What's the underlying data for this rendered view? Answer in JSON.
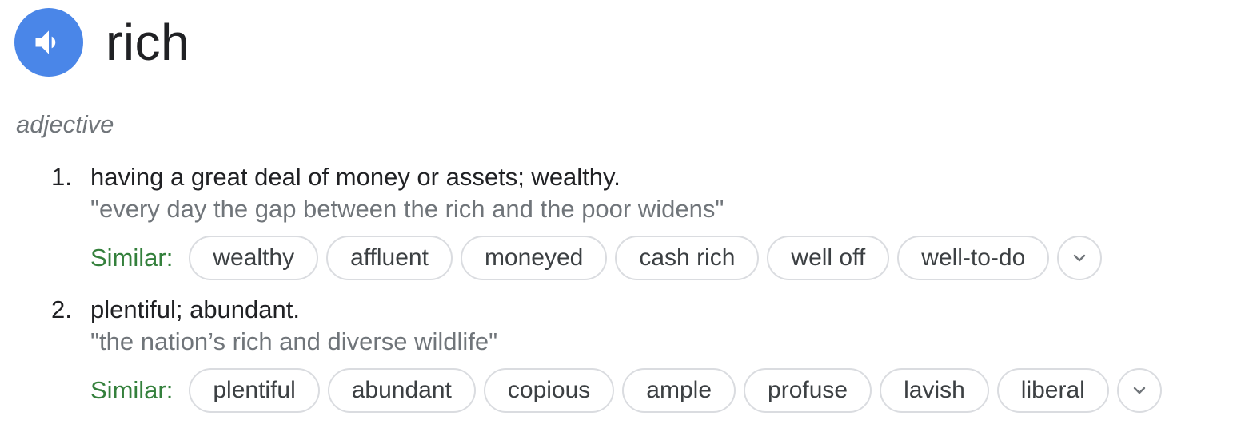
{
  "entry": {
    "word": "rich",
    "speaker_icon": "speaker-volume-icon",
    "part_of_speech": "adjective"
  },
  "similar_label": "Similar:",
  "senses": [
    {
      "number": "1.",
      "definition": "having a great deal of money or assets; wealthy.",
      "example": "\"every day the gap between the rich and the poor widens\"",
      "similar": [
        "wealthy",
        "affluent",
        "moneyed",
        "cash rich",
        "well off",
        "well-to-do"
      ]
    },
    {
      "number": "2.",
      "definition": "plentiful; abundant.",
      "example": "\"the nation’s rich and diverse wildlife\"",
      "similar": [
        "plentiful",
        "abundant",
        "copious",
        "ample",
        "profuse",
        "lavish",
        "liberal"
      ]
    }
  ],
  "colors": {
    "speaker_bg": "#4a86e8",
    "similar_label": "#34803c",
    "muted_text": "#70757a",
    "chip_border": "#dadce0"
  }
}
